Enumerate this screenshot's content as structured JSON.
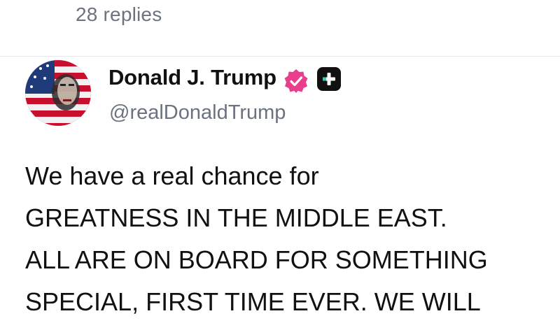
{
  "thread": {
    "replies_label": "28 replies"
  },
  "post": {
    "author": {
      "name": "Donald J. Trump",
      "handle": "@realDonaldTrump",
      "avatar_icon": "flag-portrait-avatar",
      "verified_icon": "verified-badge-icon",
      "premium_icon": "plus-badge-icon"
    },
    "body_lines": [
      "We have a real chance for",
      "GREATNESS IN THE MIDDLE EAST.",
      "ALL ARE ON BOARD FOR SOMETHING",
      "SPECIAL, FIRST TIME EVER. WE WILL"
    ]
  },
  "colors": {
    "text_primary": "#111111",
    "text_secondary": "#6b7280",
    "verified_pink": "#e83e8c",
    "badge_dark": "#111111",
    "background": "#ffffff"
  }
}
